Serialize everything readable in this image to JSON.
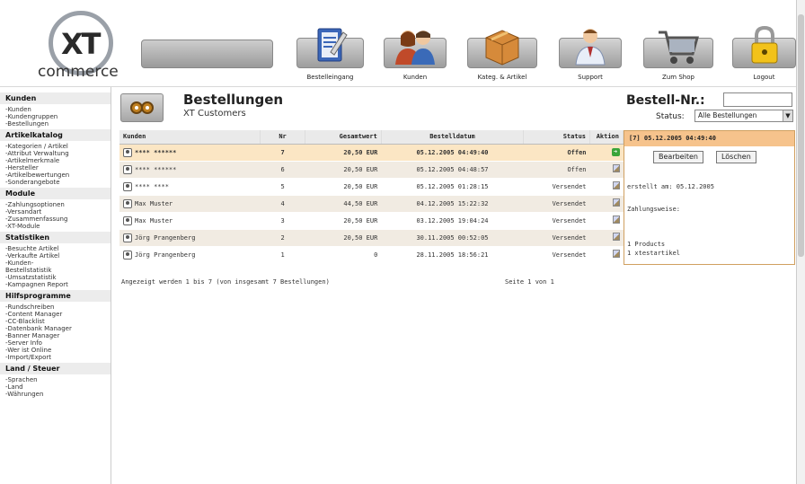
{
  "logo": {
    "xt": "XT",
    "commerce": "commerce"
  },
  "nav": [
    {
      "label": "Bestelleingang",
      "icon": "clipboard-icon"
    },
    {
      "label": "Kunden",
      "icon": "customers-icon"
    },
    {
      "label": "Kateg. & Artikel",
      "icon": "box-icon"
    },
    {
      "label": "Support",
      "icon": "support-person-icon"
    },
    {
      "label": "Zum Shop",
      "icon": "shopping-cart-icon"
    },
    {
      "label": "Logout",
      "icon": "padlock-icon"
    }
  ],
  "sidebar": [
    {
      "head": "Kunden",
      "items": [
        "-Kunden",
        "-Kundengruppen",
        "-Bestellungen"
      ]
    },
    {
      "head": "Artikelkatalog",
      "items": [
        "-Kategorien / Artikel",
        "-Attribut Verwaltung",
        "-Artikelmerkmale",
        "-Hersteller",
        "-Artikelbewertungen",
        "-Sonderangebote"
      ]
    },
    {
      "head": "Module",
      "items": [
        "-Zahlungsoptionen",
        "-Versandart",
        "-Zusammenfassung",
        "-XT-Module"
      ]
    },
    {
      "head": "Statistiken",
      "items": [
        "-Besuchte Artikel",
        "-Verkaufte Artikel",
        "-Kunden-",
        "Bestellstatistik",
        "-Umsatzstatistik",
        "-Kampagnen Report"
      ]
    },
    {
      "head": "Hilfsprogramme",
      "items": [
        "-Rundschreiben",
        "-Content Manager",
        "-CC-Blacklist",
        "-Datenbank Manager",
        "-Banner Manager",
        "-Server Info",
        "-Wer ist Online",
        "-Import/Export"
      ]
    },
    {
      "head": "Land / Steuer",
      "items": [
        "-Sprachen",
        "-Land",
        "-Währungen"
      ]
    }
  ],
  "page": {
    "title": "Bestellungen",
    "subtitle": "XT Customers",
    "order_nr_label": "Bestell-Nr.:",
    "order_nr_value": "",
    "status_label": "Status:",
    "status_selected": "Alle Bestellungen",
    "status_arrow": "▼"
  },
  "table": {
    "headers": [
      "Kunden",
      "Nr",
      "Gesamtwert",
      "Bestelldatum",
      "Status",
      "Aktion"
    ],
    "rows": [
      {
        "kunde": "**** ******",
        "nr": "7",
        "sum": "20,50 EUR",
        "date": "05.12.2005 04:49:40",
        "status": "Offen",
        "action": "go"
      },
      {
        "kunde": "**** ******",
        "nr": "6",
        "sum": "20,50 EUR",
        "date": "05.12.2005 04:48:57",
        "status": "Offen",
        "action": "edit"
      },
      {
        "kunde": "**** ****",
        "nr": "5",
        "sum": "20,50 EUR",
        "date": "05.12.2005 01:28:15",
        "status": "Versendet",
        "action": "edit"
      },
      {
        "kunde": "Max Muster",
        "nr": "4",
        "sum": "44,50 EUR",
        "date": "04.12.2005 15:22:32",
        "status": "Versendet",
        "action": "edit"
      },
      {
        "kunde": "Max Muster",
        "nr": "3",
        "sum": "20,50 EUR",
        "date": "03.12.2005 19:04:24",
        "status": "Versendet",
        "action": "edit"
      },
      {
        "kunde": "Jörg Prangenberg",
        "nr": "2",
        "sum": "20,50 EUR",
        "date": "30.11.2005 00:52:05",
        "status": "Versendet",
        "action": "edit"
      },
      {
        "kunde": "Jörg Prangenberg",
        "nr": "1",
        "sum": "0",
        "date": "28.11.2005 18:56:21",
        "status": "Versendet",
        "action": "edit"
      }
    ],
    "footer_left": "Angezeigt werden 1 bis 7 (von insgesamt 7 Bestellungen)",
    "footer_right": "Seite 1 von 1"
  },
  "detail": {
    "header": "[7] 05.12.2005 04:49:40",
    "edit_label": "Bearbeiten",
    "delete_label": "Löschen",
    "created": "erstellt am: 05.12.2005",
    "payment": "Zahlungsweise:",
    "products": "1 Products",
    "product_item": "1 xtestartikel"
  }
}
